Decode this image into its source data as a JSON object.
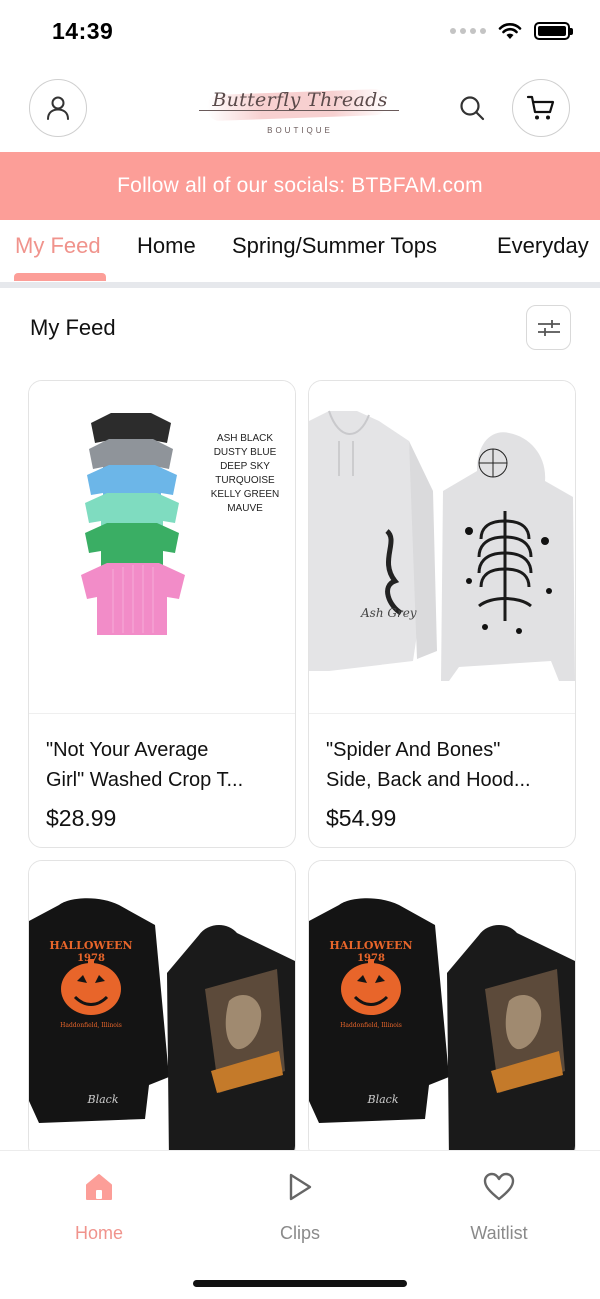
{
  "status_bar": {
    "time": "14:39"
  },
  "header": {
    "logo_script": "Butterfly Threads",
    "logo_sub": "BOUTIQUE"
  },
  "banner": {
    "text": "Follow all of our socials: BTBFAM.com",
    "color": "#fc9e98"
  },
  "tabs": [
    {
      "label": "My Feed",
      "active": true
    },
    {
      "label": "Home"
    },
    {
      "label": "Spring/Summer Tops"
    },
    {
      "label": "Everyday"
    }
  ],
  "section": {
    "title": "My Feed"
  },
  "products": [
    {
      "title_line1": "\"Not Your Average",
      "title_line2": "Girl\" Washed Crop T...",
      "price": "$28.99",
      "image_labels": [
        "ASH BLACK",
        "DUSTY BLUE",
        "DEEP SKY",
        "TURQUOISE",
        "KELLY GREEN",
        "MAUVE"
      ]
    },
    {
      "title_line1": "\"Spider And Bones\"",
      "title_line2": "Side, Back and Hood...",
      "price": "$54.99",
      "image_label": "Ash Grey"
    },
    {
      "image_title": "HALLOWEEN",
      "image_year": "1978",
      "image_town": "Haddonfield, Illinois",
      "image_label": "Black"
    },
    {
      "image_title": "HALLOWEEN",
      "image_year": "1978",
      "image_town": "Haddonfield, Illinois",
      "image_label": "Black"
    }
  ],
  "bottom_nav": [
    {
      "label": "Home",
      "icon": "home-icon",
      "active": true
    },
    {
      "label": "Clips",
      "icon": "play-icon"
    },
    {
      "label": "Waitlist",
      "icon": "heart-icon"
    }
  ],
  "colors": {
    "accent": "#fc9e98",
    "accent_text": "#f0938c"
  }
}
